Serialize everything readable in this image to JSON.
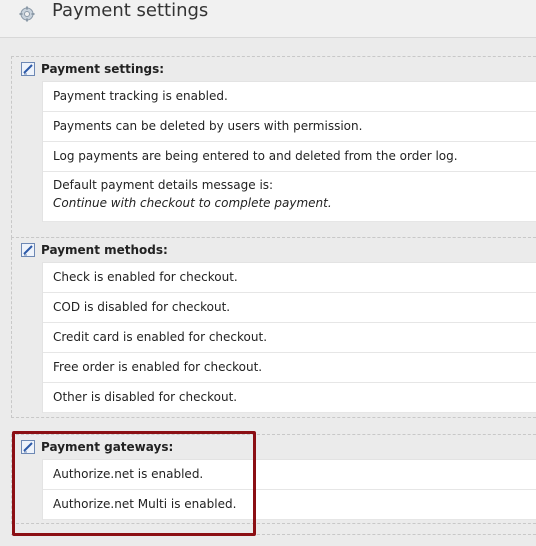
{
  "page": {
    "title": "Payment settings",
    "icon": "settings-cog-icon"
  },
  "sections": [
    {
      "title": "Payment settings:",
      "icon": "edit-icon",
      "items": [
        "Payment tracking is enabled.",
        "Payments can be deleted by users with permission.",
        "Log payments are being entered to and deleted from the order log."
      ],
      "message_label": "Default payment details message is:",
      "message_value": "Continue with checkout to complete payment."
    },
    {
      "title": "Payment methods:",
      "icon": "edit-icon",
      "items": [
        "Check is enabled for checkout.",
        "COD is disabled for checkout.",
        "Credit card is enabled for checkout.",
        "Free order is enabled for checkout.",
        "Other is disabled for checkout."
      ]
    },
    {
      "title": "Payment gateways:",
      "icon": "edit-icon",
      "items": [
        "Authorize.net is enabled.",
        "Authorize.net Multi is enabled."
      ]
    }
  ],
  "colors": {
    "highlight_border": "#8b0f14",
    "background": "#ebebeb"
  }
}
